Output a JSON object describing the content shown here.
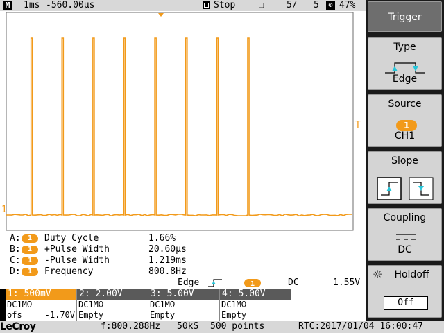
{
  "topbar": {
    "mode_icon": "M",
    "timebase": "1ms",
    "delay": "-560.00µs",
    "run_state": "Stop",
    "acq_count": "5/",
    "acq_total": "5",
    "battery": "47%"
  },
  "markers": {
    "trigger_level": "T",
    "channel1": "1"
  },
  "measurements": [
    {
      "letter": "A:",
      "channel": "1",
      "label": "Duty Cycle",
      "value": "1.66%"
    },
    {
      "letter": "B:",
      "channel": "1",
      "label": "+Pulse Width",
      "value": "20.60µs"
    },
    {
      "letter": "C:",
      "channel": "1",
      "label": "-Pulse Width",
      "value": "1.219ms"
    },
    {
      "letter": "D:",
      "channel": "1",
      "label": "Frequency",
      "value": "800.8Hz"
    }
  ],
  "trigger_summary": {
    "type": "Edge",
    "source_channel": "1",
    "coupling": "DC",
    "level": "1.55V"
  },
  "channels": [
    {
      "header": "1: 500mV",
      "coupling": "DC1MΩ",
      "offset_label": "ofs",
      "offset_value": "-1.70V"
    },
    {
      "header": "2: 2.00V",
      "coupling": "DC1MΩ",
      "state": "Empty"
    },
    {
      "header": "3: 5.00V",
      "coupling": "DC1MΩ",
      "state": "Empty"
    },
    {
      "header": "4: 5.00V",
      "coupling": "DC1MΩ",
      "state": "Empty"
    }
  ],
  "bottombar": {
    "brand": "LeCroy",
    "freq_counter": "f:800.288Hz",
    "sample_rate": "50kS",
    "record_length": "500 points",
    "rtc": "RTC:2017/01/04 16:00:47"
  },
  "menu": {
    "title": "Trigger",
    "type_label": "Type",
    "type_value": "Edge",
    "source_label": "Source",
    "source_badge": "1",
    "source_value": "CH1",
    "slope_label": "Slope",
    "coupling_label": "Coupling",
    "coupling_value": "DC",
    "holdoff_label": "Holdoff",
    "holdoff_value": "Off"
  },
  "colors": {
    "trace": "#f29a1a",
    "trigger_icon": "#26c6da"
  },
  "waveform": {
    "period_ms": 1.249,
    "pulse_width_us": 20.6,
    "pulse_count_visible": 8
  }
}
